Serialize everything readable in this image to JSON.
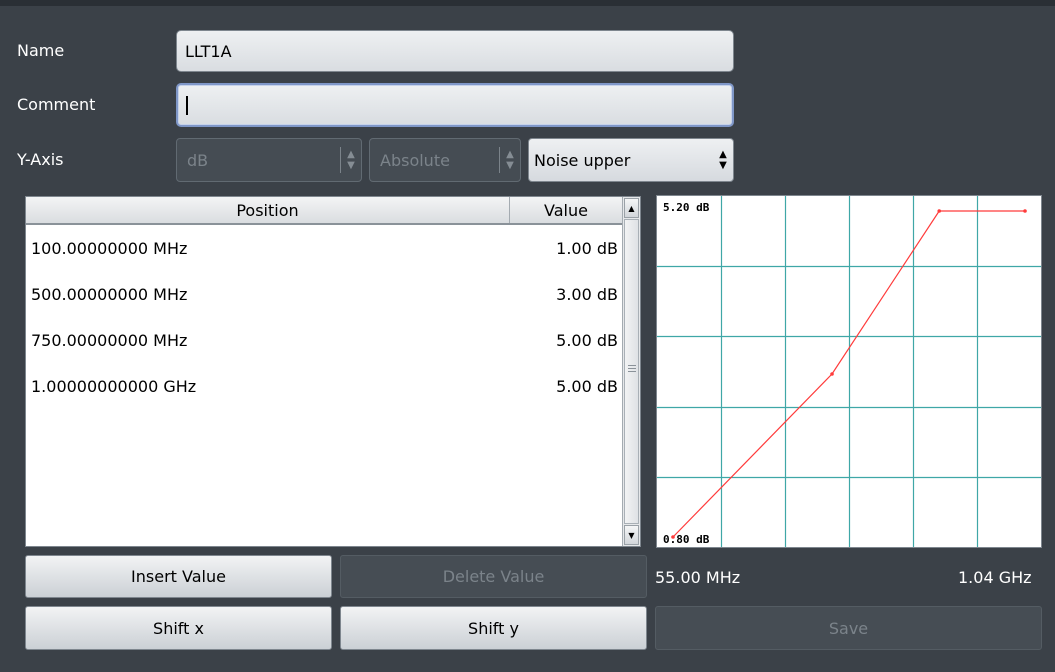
{
  "form": {
    "name_label": "Name",
    "name_value": "LLT1A",
    "comment_label": "Comment",
    "comment_value": "",
    "yaxis_label": "Y-Axis",
    "yaxis_unit": "dB",
    "yaxis_mode": "Absolute",
    "yaxis_type": "Noise upper"
  },
  "table": {
    "headers": {
      "position": "Position",
      "value": "Value"
    },
    "rows": [
      {
        "position": "100.00000000 MHz",
        "value": "1.00 dB"
      },
      {
        "position": "500.00000000 MHz",
        "value": "3.00 dB"
      },
      {
        "position": "750.00000000 MHz",
        "value": "5.00 dB"
      },
      {
        "position": "1.00000000000 GHz",
        "value": "5.00 dB"
      }
    ]
  },
  "chart": {
    "y_max_label": "5.20 dB",
    "y_min_label": "0.80 dB",
    "x_min_label": "55.00 MHz",
    "x_max_label": "1.04 GHz",
    "line_color": "#ff3b3b",
    "grid_color": "#3fa7a7"
  },
  "chart_data": {
    "type": "line",
    "x_unit": "MHz",
    "y_unit": "dB",
    "xlim": [
      55,
      1040
    ],
    "ylim": [
      0.8,
      5.2
    ],
    "grid": true,
    "series": [
      {
        "x": [
          55,
          500,
          800,
          1040
        ],
        "y": [
          0.8,
          3.0,
          5.2,
          5.2
        ]
      }
    ]
  },
  "buttons": {
    "insert_value": "Insert Value",
    "delete_value": "Delete Value",
    "shift_x": "Shift x",
    "shift_y": "Shift y",
    "save": "Save"
  }
}
